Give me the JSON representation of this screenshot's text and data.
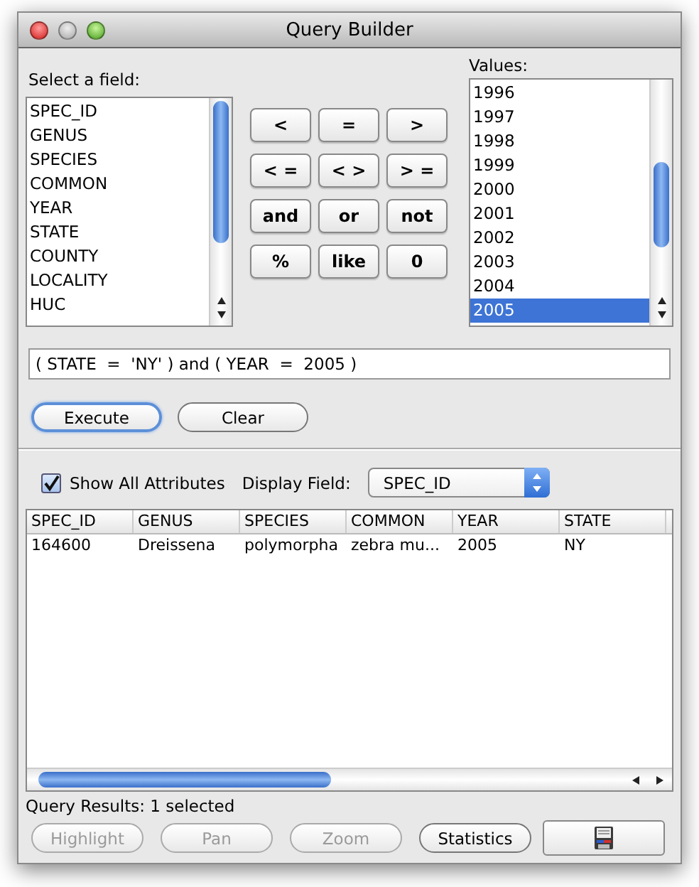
{
  "window": {
    "title": "Query Builder"
  },
  "field_list": {
    "label": "Select a field:",
    "items": [
      {
        "text": "SPEC_ID",
        "selected": false
      },
      {
        "text": "GENUS",
        "selected": false
      },
      {
        "text": "SPECIES",
        "selected": false
      },
      {
        "text": "COMMON",
        "selected": false
      },
      {
        "text": "YEAR",
        "selected": false
      },
      {
        "text": "STATE",
        "selected": false
      },
      {
        "text": "COUNTY",
        "selected": false
      },
      {
        "text": "LOCALITY",
        "selected": false
      },
      {
        "text": "HUC",
        "selected": false
      }
    ]
  },
  "operators": [
    "<",
    "=",
    ">",
    "< =",
    "< >",
    "> =",
    "and",
    "or",
    "not",
    "%",
    "like",
    "0"
  ],
  "values_list": {
    "label": "Values:",
    "items": [
      {
        "text": "1996",
        "selected": false
      },
      {
        "text": "1997",
        "selected": false
      },
      {
        "text": "1998",
        "selected": false
      },
      {
        "text": "1999",
        "selected": false
      },
      {
        "text": "2000",
        "selected": false
      },
      {
        "text": "2001",
        "selected": false
      },
      {
        "text": "2002",
        "selected": false
      },
      {
        "text": "2003",
        "selected": false
      },
      {
        "text": "2004",
        "selected": false
      },
      {
        "text": "2005",
        "selected": true
      }
    ]
  },
  "expression": {
    "value": "( STATE  =  'NY' ) and ( YEAR  =  2005 )"
  },
  "actions": [
    {
      "label": "Execute",
      "default": true
    },
    {
      "label": "Clear",
      "default": false
    }
  ],
  "show_all": {
    "label": "Show All Attributes",
    "checked": true
  },
  "display_field": {
    "label": "Display Field:",
    "value": "SPEC_ID"
  },
  "results": {
    "columns": [
      "SPEC_ID",
      "GENUS",
      "SPECIES",
      "COMMON",
      "YEAR",
      "STATE"
    ],
    "rows": [
      [
        "164600",
        "Dreissena",
        "polymorpha",
        "zebra mu...",
        "2005",
        "NY"
      ]
    ]
  },
  "status": "Query Results: 1 selected",
  "bottom_buttons": [
    {
      "kind": "text",
      "label": "Highlight",
      "disabled": true
    },
    {
      "kind": "text",
      "label": "Pan",
      "disabled": true
    },
    {
      "kind": "text",
      "label": "Zoom",
      "disabled": true
    },
    {
      "kind": "text",
      "label": "Statistics",
      "disabled": false
    },
    {
      "kind": "save",
      "disabled": false
    }
  ]
}
